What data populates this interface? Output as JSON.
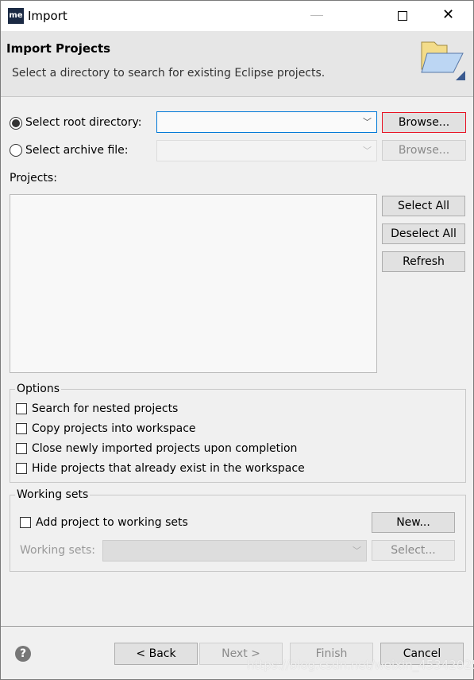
{
  "window": {
    "title": "Import",
    "app_icon": "me-icon",
    "controls": [
      "minimize",
      "maximize",
      "close"
    ]
  },
  "banner": {
    "title": "Import Projects",
    "description": "Select a directory to search for existing Eclipse projects.",
    "icon": "folder-open-icon"
  },
  "source": {
    "root_dir_label": "Select root directory:",
    "root_dir_selected": true,
    "root_dir_value": "",
    "browse_label": "Browse...",
    "archive_label": "Select archive file:",
    "archive_selected": false,
    "archive_value": "",
    "archive_browse_label": "Browse..."
  },
  "projects": {
    "label": "Projects:",
    "items": [],
    "select_all": "Select All",
    "deselect_all": "Deselect All",
    "refresh": "Refresh"
  },
  "options": {
    "legend": "Options",
    "items": [
      {
        "label": "Search for nested projects",
        "checked": false
      },
      {
        "label": "Copy projects into workspace",
        "checked": false
      },
      {
        "label": "Close newly imported projects upon completion",
        "checked": false
      },
      {
        "label": "Hide projects that already exist in the workspace",
        "checked": false
      }
    ]
  },
  "working_sets": {
    "legend": "Working sets",
    "add_label": "Add project to working sets",
    "add_checked": false,
    "new_label": "New...",
    "sets_label": "Working sets:",
    "sets_value": "",
    "select_label": "Select..."
  },
  "footer": {
    "help_icon": "help-icon",
    "back": "< Back",
    "next": "Next >",
    "finish": "Finish",
    "cancel": "Cancel"
  },
  "watermark": "https://blog.csdn.net/weixin_45342025",
  "colors": {
    "focus_border": "#0078d7",
    "default_button_border": "#e81123"
  }
}
